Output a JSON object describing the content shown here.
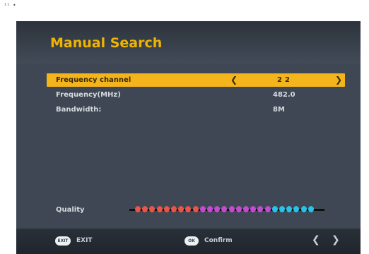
{
  "corner_mark": "¹¹ •",
  "title": "Manual Search",
  "rows": [
    {
      "label": "Frequency channel",
      "value": "22",
      "arrow_left": "❮",
      "arrow_right": "❯"
    },
    {
      "label": "Frequency(MHz)",
      "value": "482.0"
    },
    {
      "label": "Bandwidth:",
      "value": "8M"
    }
  ],
  "quality": {
    "label": "Quality",
    "dot_colors": [
      "#e8564a",
      "#e8564a",
      "#e8564a",
      "#e8564a",
      "#e8564a",
      "#e8564a",
      "#e8564a",
      "#e8564a",
      "#e8564a",
      "#c34bd0",
      "#c34bd0",
      "#c34bd0",
      "#c34bd0",
      "#c34bd0",
      "#c34bd0",
      "#c34bd0",
      "#c34bd0",
      "#c34bd0",
      "#c34bd0",
      "#27c4ea",
      "#27c4ea",
      "#27c4ea",
      "#27c4ea",
      "#27c4ea",
      "#27c4ea"
    ]
  },
  "footer": {
    "exit_key": "EXIT",
    "exit_label": "EXIT",
    "ok_key": "OK",
    "confirm_label": "Confirm",
    "nav_left": "❮",
    "nav_right": "❯"
  }
}
